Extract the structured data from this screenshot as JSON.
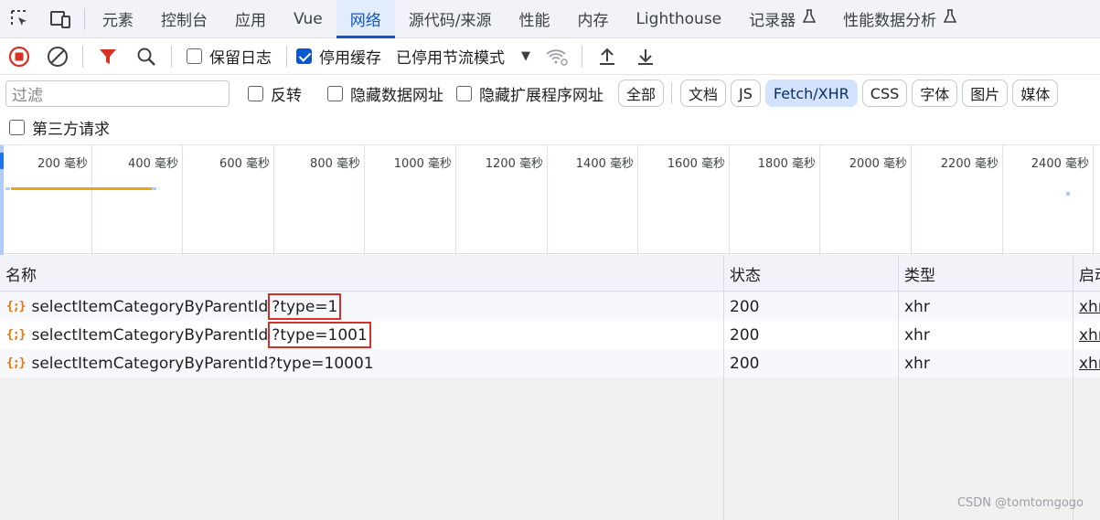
{
  "tabs": {
    "elements": "元素",
    "console": "控制台",
    "application": "应用",
    "vue": "Vue",
    "network": "网络",
    "sources": "源代码/来源",
    "performance": "性能",
    "memory": "内存",
    "lighthouse": "Lighthouse",
    "recorder": "记录器",
    "perf_insights": "性能数据分析"
  },
  "toolbar": {
    "preserve_log": "保留日志",
    "disable_cache": "停用缓存",
    "disable_cache_checked": true,
    "preserve_log_checked": false,
    "throttle": "已停用节流模式"
  },
  "filter": {
    "placeholder": "过滤",
    "invert": "反转",
    "hide_data_urls": "隐藏数据网址",
    "hide_extension_urls": "隐藏扩展程序网址",
    "types": [
      "全部",
      "文档",
      "JS",
      "Fetch/XHR",
      "CSS",
      "字体",
      "图片",
      "媒体"
    ],
    "active_type": "Fetch/XHR",
    "third_party": "第三方请求"
  },
  "overview": {
    "ticks": [
      "200 毫秒",
      "400 毫秒",
      "600 毫秒",
      "800 毫秒",
      "1000 毫秒",
      "1200 毫秒",
      "1400 毫秒",
      "1600 毫秒",
      "1800 毫秒",
      "2000 毫秒",
      "2200 毫秒",
      "2400 毫秒"
    ]
  },
  "table": {
    "headers": {
      "name": "名称",
      "status": "状态",
      "type": "类型",
      "initiator": "启动"
    },
    "rows": [
      {
        "name_base": "selectItemCategoryByParentId",
        "name_query": "?type=1",
        "status": "200",
        "type": "xhr",
        "initiator": "xhr"
      },
      {
        "name_base": "selectItemCategoryByParentId",
        "name_query": "?type=1001",
        "status": "200",
        "type": "xhr",
        "initiator": "xhr"
      },
      {
        "name_base": "selectItemCategoryByParentId",
        "name_query": "?type=10001",
        "status": "200",
        "type": "xhr",
        "initiator": "xhr"
      }
    ]
  },
  "watermark": "CSDN @tomtomgogo",
  "colors": {
    "accent": "#0b57d0",
    "record_red": "#d93025",
    "highlight_box": "#d93025",
    "fetch_icon": "#e37400"
  }
}
